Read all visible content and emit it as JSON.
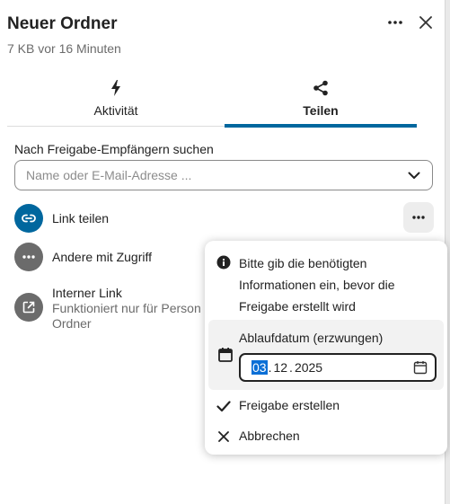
{
  "header": {
    "title": "Neuer Ordner",
    "subtitle": "7 KB vor 16 Minuten",
    "more_icon": "more-horizontal-icon",
    "close_icon": "close-icon"
  },
  "tabs": [
    {
      "label": "Aktivität",
      "icon": "lightning-icon",
      "active": false
    },
    {
      "label": "Teilen",
      "icon": "share-icon",
      "active": true
    }
  ],
  "search": {
    "label": "Nach Freigabe-Empfängern suchen",
    "placeholder": "Name oder E-Mail-Adresse ...",
    "value": ""
  },
  "rows": {
    "link": {
      "label": "Link teilen",
      "icon": "link-icon"
    },
    "others": {
      "label": "Andere mit Zugriff",
      "icon": "more-horizontal-icon"
    },
    "internal": {
      "title": "Interner Link",
      "description_line1": "Funktioniert nur für Person",
      "description_line2": "Ordner",
      "icon": "external-link-icon"
    }
  },
  "popup": {
    "info_text": "Bitte gib die benötigten Informationen ein, bevor die Freigabe erstellt wird",
    "expire_label": "Ablaufdatum (erzwungen)",
    "date": {
      "day": "03",
      "month": "12",
      "year": "2025",
      "separator": "."
    },
    "create_label": "Freigabe erstellen",
    "cancel_label": "Abbrechen"
  },
  "colors": {
    "accent": "#00679e",
    "avatar_gray": "#6b6b6b",
    "date_selection": "#0a6fd6"
  }
}
